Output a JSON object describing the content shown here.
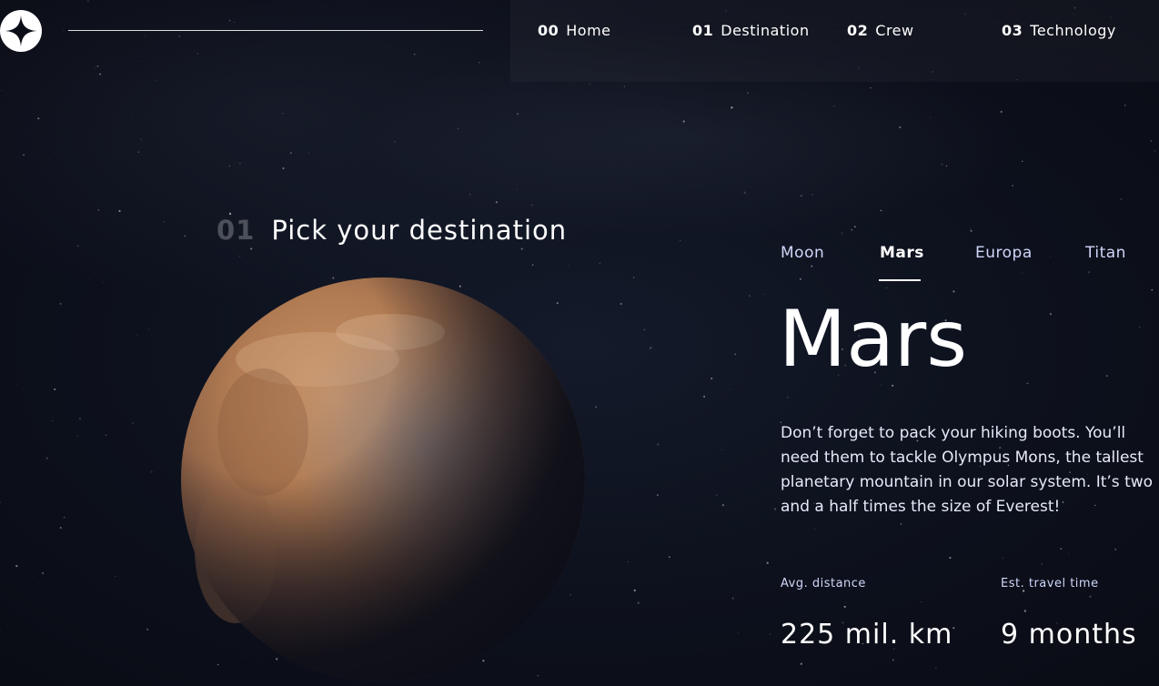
{
  "nav": {
    "items": [
      {
        "num": "00",
        "label": "Home"
      },
      {
        "num": "01",
        "label": "Destination"
      },
      {
        "num": "02",
        "label": "Crew"
      },
      {
        "num": "03",
        "label": "Technology"
      }
    ]
  },
  "heading": {
    "num": "01",
    "title": "Pick your destination"
  },
  "tabs": [
    {
      "label": "Moon"
    },
    {
      "label": "Mars"
    },
    {
      "label": "Europa"
    },
    {
      "label": "Titan"
    }
  ],
  "active_tab": "Mars",
  "destination": {
    "name": "Mars",
    "description": "Don’t forget to pack your hiking boots. You’ll need them to tackle Olympus Mons, the tallest planetary mountain in our solar system. It’s two and a half times the size of Everest!",
    "distance_label": "Avg. distance",
    "distance_value": "225 mil. km",
    "travel_label": "Est. travel time",
    "travel_value": "9 months"
  },
  "icons": {
    "logo": "star-logo-icon"
  },
  "colors": {
    "background": "#0b0d17",
    "text": "#ffffff",
    "muted": "#d0d6f9"
  }
}
